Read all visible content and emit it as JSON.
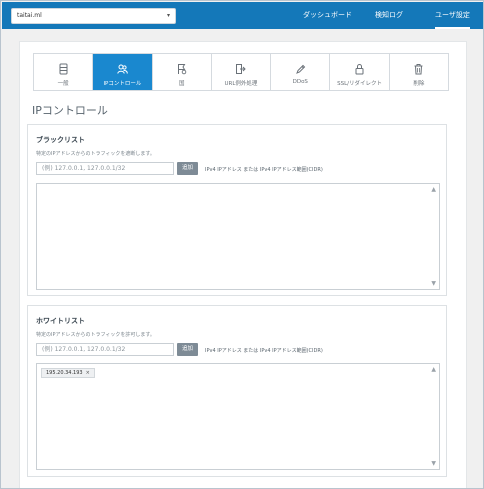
{
  "topbar": {
    "domain_value": "taitai.ml",
    "nav": [
      {
        "label": "ダッシュボード"
      },
      {
        "label": "検知ログ"
      },
      {
        "label": "ユーザ設定"
      }
    ],
    "color": "#1478b9"
  },
  "tabs": [
    {
      "label": "一般",
      "icon": "server-icon"
    },
    {
      "label": "IPコントロール",
      "icon": "users-icon"
    },
    {
      "label": "国",
      "icon": "flag-icon"
    },
    {
      "label": "URL例外処理",
      "icon": "exit-icon"
    },
    {
      "label": "DDoS",
      "icon": "pen-icon"
    },
    {
      "label": "SSL/リダイレクト",
      "icon": "lock-icon"
    },
    {
      "label": "削除",
      "icon": "trash-icon"
    }
  ],
  "active_tab_color": "#1a88cf",
  "page_title": "IPコントロール",
  "blacklist": {
    "title": "ブラックリスト",
    "description": "特定のIPアドレスからのトラフィックを遮断します。",
    "placeholder": "(例) 127.0.0.1, 127.0.0.1/32",
    "add_label": "追加",
    "hint": "IPv4 IPアドレス または IPv4 IPアドレス範囲(CIDR)",
    "entries": []
  },
  "whitelist": {
    "title": "ホワイトリスト",
    "description": "特定のIPアドレスからのトラフィックを許可します。",
    "placeholder": "(例) 127.0.0.1, 127.0.0.1/32",
    "add_label": "追加",
    "hint": "IPv4 IPアドレス または IPv4 IPアドレス範囲(CIDR)",
    "entries": [
      {
        "ip": "195.20.34.193",
        "remove": "×"
      }
    ]
  }
}
